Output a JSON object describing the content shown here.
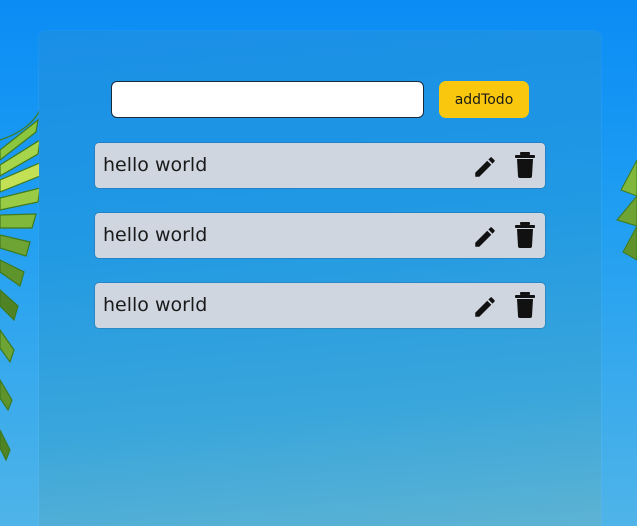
{
  "form": {
    "input_value": "",
    "input_placeholder": "",
    "add_label": "addTodo"
  },
  "todos": [
    {
      "text": "hello world",
      "edit_icon": "pencil-icon",
      "delete_icon": "trash-icon"
    },
    {
      "text": "hello world",
      "edit_icon": "pencil-icon",
      "delete_icon": "trash-icon"
    },
    {
      "text": "hello world",
      "edit_icon": "pencil-icon",
      "delete_icon": "trash-icon"
    }
  ],
  "colors": {
    "background_sky": "#0a8cf5",
    "panel": "#2199e3",
    "add_button": "#f9c80e",
    "todo_item": "#cfd6e0",
    "text": "#1a1a1a"
  },
  "background_image": "palm-leaves-sky"
}
